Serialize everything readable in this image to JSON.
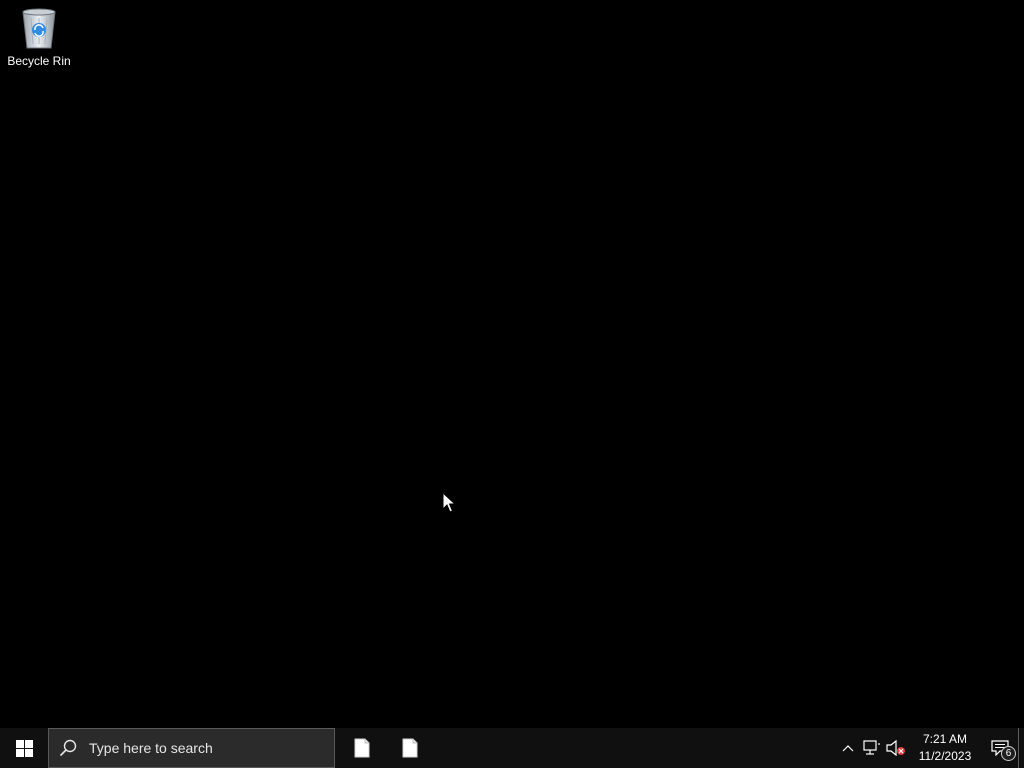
{
  "desktop": {
    "icons": [
      {
        "label": "Becycle Rin",
        "icon": "recycle-bin-icon"
      }
    ],
    "background_color": "#000000"
  },
  "taskbar": {
    "start_icon": "windows-logo-icon",
    "search": {
      "placeholder": "Type here to search",
      "icon": "search-icon"
    },
    "apps": [
      {
        "icon": "document-icon"
      },
      {
        "icon": "document-icon"
      }
    ],
    "tray": {
      "icons": [
        "chevron-up-icon",
        "network-icon",
        "volume-muted-icon"
      ],
      "clock": {
        "time": "7:21 AM",
        "date": "11/2/2023"
      },
      "notifications": {
        "icon": "notification-icon",
        "count": "6"
      }
    }
  }
}
